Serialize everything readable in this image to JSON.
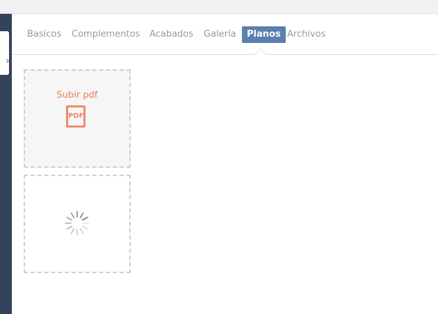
{
  "tabs": {
    "basicos": "Basicos",
    "complementos": "Complementos",
    "acabados": "Acabados",
    "galeria": "Galería",
    "planos": "Planos",
    "archivos": "Archivos",
    "active": "Planos"
  },
  "upload": {
    "label": "Subir pdf",
    "icon": "pdf-icon",
    "icon_text": "PDF"
  },
  "loading": {
    "icon": "spinner-icon"
  },
  "colors": {
    "sidebar": "#34425a",
    "active_tab": "#5b7fae",
    "accent": "#f07a57"
  }
}
